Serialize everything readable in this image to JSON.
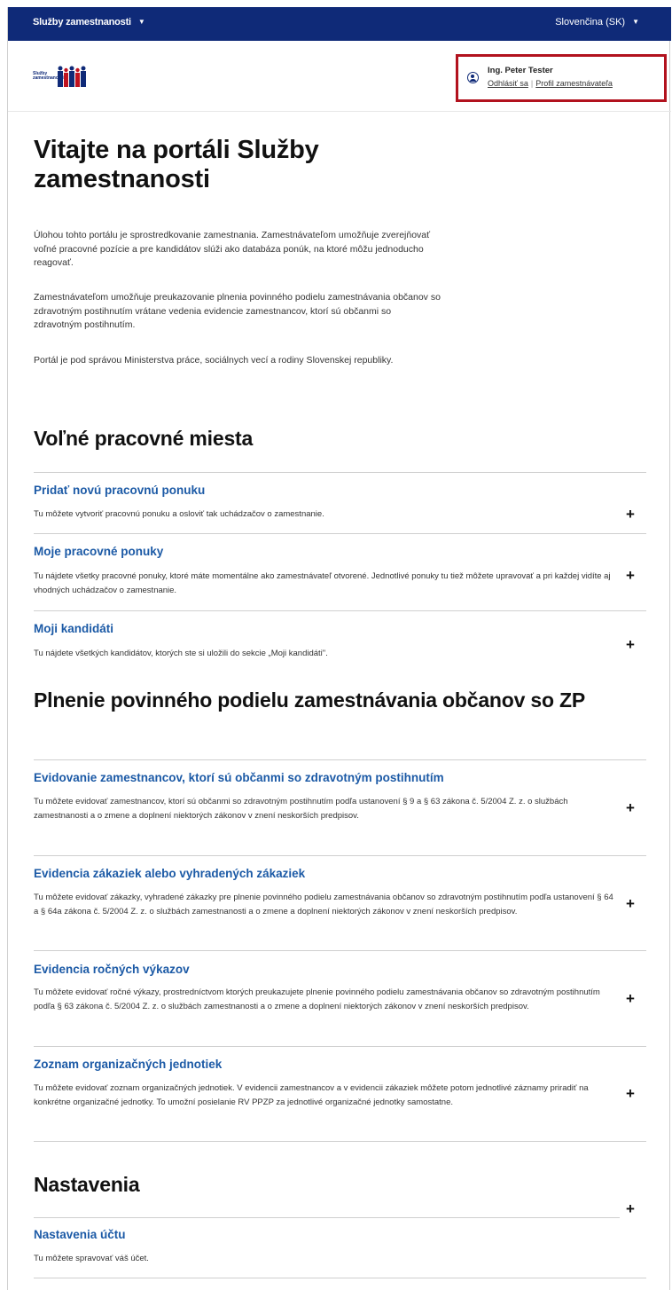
{
  "topbar": {
    "services_menu": "Služby zamestnanosti",
    "language": "Slovenčina (SK)",
    "caret_icon": "chevron-down-icon"
  },
  "header": {
    "logo_text": "Služby zamestnanosti",
    "user": {
      "name": "Ing. Peter Tester",
      "logout": "Odhlásiť sa",
      "separator": "|",
      "profile": "Profil zamestnávateľa"
    }
  },
  "main": {
    "title": "Vitajte na portáli Služby zamestnanosti",
    "intro": [
      "Úlohou tohto portálu je sprostredkovanie zamestnania. Zamestnávateľom umožňuje zverejňovať voľné pracovné pozície a pre kandidátov slúži ako databáza ponúk, na ktoré môžu jednoducho reagovať.",
      "Zamestnávateľom umožňuje preukazovanie plnenia povinného podielu zamestnávania občanov so zdravotným postihnutím vrátane vedenia evidencie zamestnancov, ktorí sú občanmi so zdravotným postihnutím.",
      "Portál je pod správou Ministerstva práce, sociálnych vecí a rodiny Slovenskej republiky."
    ],
    "sections": [
      {
        "title": "Voľné pracovné miesta",
        "items": [
          {
            "link": "Pridať novú pracovnú ponuku",
            "desc": "Tu môžete vytvoriť pracovnú ponuku a osloviť tak uchádzačov o zamestnanie."
          },
          {
            "link": "Moje pracovné ponuky",
            "desc": "Tu nájdete všetky pracovné ponuky, ktoré máte momentálne ako zamestnávateľ otvorené. Jednotlivé ponuky tu tiež môžete upravovať a pri každej vidíte aj vhodných uchádzačov o zamestnanie."
          },
          {
            "link": "Moji kandidáti",
            "desc": "Tu nájdete všetkých kandidátov, ktorých ste si uložili do sekcie „Moji kandidáti\"."
          }
        ]
      },
      {
        "title": "Plnenie povinného podielu zamestnávania občanov so ZP",
        "items": [
          {
            "link": "Evidovanie zamestnancov, ktorí sú občanmi so zdravotným postihnutím",
            "desc": "Tu môžete evidovať zamestnancov, ktorí sú občanmi so zdravotným postihnutím podľa ustanovení § 9 a § 63 zákona č. 5/2004 Z. z. o službách zamestnanosti a o zmene a doplnení niektorých zákonov v znení neskorších predpisov."
          },
          {
            "link": "Evidencia zákaziek alebo vyhradených zákaziek",
            "desc": "Tu môžete evidovať zákazky, vyhradené zákazky pre plnenie povinného podielu zamestnávania občanov so zdravotným postihnutím podľa ustanovení § 64 a § 64a zákona č. 5/2004 Z. z. o službách zamestnanosti a o zmene a doplnení niektorých zákonov v znení neskorších predpisov."
          },
          {
            "link": "Evidencia ročných výkazov",
            "desc": "Tu môžete evidovať ročné výkazy, prostredníctvom ktorých preukazujete plnenie povinného podielu zamestnávania občanov so zdravotným postihnutím podľa § 63 zákona č. 5/2004 Z. z. o službách zamestnanosti a o zmene a doplnení niektorých zákonov v znení neskorších predpisov."
          },
          {
            "link": "Zoznam organizačných jednotiek",
            "desc": "Tu môžete evidovať zoznam organizačných jednotiek. V evidencii zamestnancov a v evidencii zákaziek môžete potom jednotlivé záznamy priradiť na konkrétne organizačné jednotky. To umožní posielanie RV PPZP za jednotlivé organizačné jednotky samostatne."
          }
        ]
      },
      {
        "title": "Nastavenia",
        "items": [
          {
            "link": "Nastavenia účtu",
            "desc": "Tu môžete spravovať váš účet."
          }
        ]
      }
    ],
    "expand_symbol": "+"
  },
  "colors": {
    "topbar": "#0f2a78",
    "link": "#1c5aa6",
    "highlight_border": "#b2121e"
  }
}
